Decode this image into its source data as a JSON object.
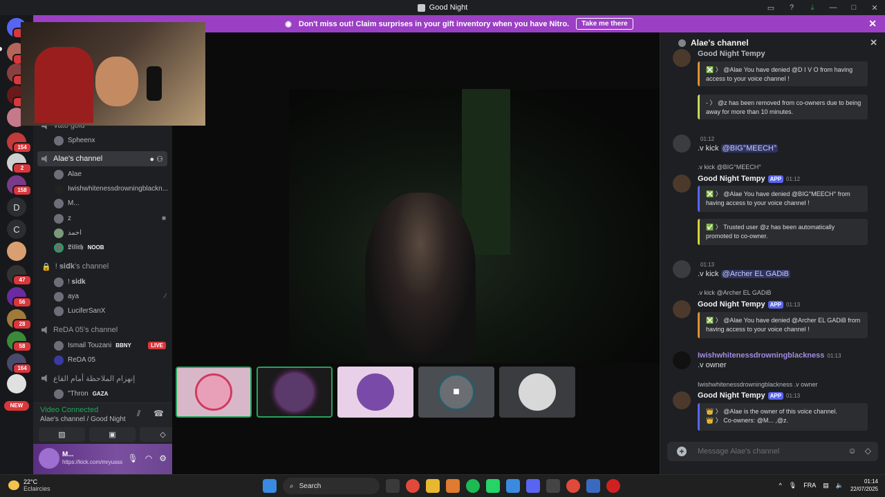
{
  "window": {
    "title": "Good Night"
  },
  "nitro_banner": {
    "text": "Don't miss out! Claim surprises in your gift inventory when you have Nitro.",
    "button": "Take me there"
  },
  "guilds": {
    "badges": [
      "7",
      "1",
      "1",
      "6",
      "154",
      "2",
      "158",
      "47",
      "56",
      "28",
      "58",
      "164"
    ],
    "letters": [
      "D",
      "C"
    ],
    "new_label": "NEW"
  },
  "channels": {
    "prev_channel_partial": "Vato gold",
    "prev_member": "Spheenx",
    "current": {
      "name": "Alae's channel",
      "members": [
        {
          "name": "Alae"
        },
        {
          "name": "Iwishwhitenessdrowningblackn..."
        },
        {
          "name": "M..."
        },
        {
          "name": "z"
        },
        {
          "name": "احمد"
        },
        {
          "name": "𝕷𝖎𝖑𝖎𝖙𝖍",
          "tag": "NOOB"
        }
      ]
    },
    "sidk": {
      "name": "! 𝐬𝐢𝐝𝐤's channel",
      "members": [
        {
          "name": "! 𝐬𝐢𝐝𝐤"
        },
        {
          "name": "aya"
        },
        {
          "name": "LuciferSanX"
        }
      ]
    },
    "reda": {
      "name": "ReDA 05's channel",
      "members": [
        {
          "name": "Ismail Touzani",
          "tag": "BBNY",
          "live": "LIVE"
        },
        {
          "name": "ReDA 05"
        }
      ]
    },
    "arabic": {
      "name": "إنهزام الملاحظة أمام القاع",
      "members": [
        {
          "name": "\"Thron",
          "tag": "GAZA"
        }
      ]
    }
  },
  "voice_panel": {
    "status": "Video Connected",
    "location": "Alae's channel / Good Night"
  },
  "user_panel": {
    "name": "M...",
    "status": "https://kick.com/mryusss"
  },
  "chat": {
    "header": "Alae's channel",
    "top_partial": "Good Night Tempy",
    "messages": [
      {
        "embed1": "❎ 〉 @Alae You have denied @D I V O from having access to your voice channel !"
      },
      {
        "embed2": "- 〉 @z has been removed from co-owners due to being away for more than 10 minutes."
      },
      {
        "time": "01:12",
        "text": ".v kick",
        "mention": "@BIG°MEECH°"
      },
      {
        "reply": ".v kick @BIG°MEECH°",
        "author": "Good Night Tempy",
        "app": "APP",
        "time": "01:12",
        "embed1": "❎ 〉 @Alae You have denied @BIG°MEECH° from having access to your voice channel !",
        "embed2": "✅ 〉 Trusted user @z has been automatically promoted to co-owner."
      },
      {
        "time": "01:13",
        "text": ".v kick",
        "mention": "@Archer EL GADiB"
      },
      {
        "reply": ".v kick @Archer EL GADiB",
        "author": "Good Night Tempy",
        "app": "APP",
        "time": "01:13",
        "embed1": "❎ 〉 @Alae You have denied @Archer EL GADiB from having access to your voice channel !"
      },
      {
        "author": "Iwishwhitenessdrowningblackness",
        "time": "01:13",
        "text": ".v owner"
      },
      {
        "reply": "Iwishwhitenessdrowningblackness .v owner",
        "author": "Good Night Tempy",
        "app": "APP",
        "time": "01:13",
        "embed1": "👑 〉 @Alae is the owner of this voice channel.",
        "embed2": "👑 〉 Co-owners: @M... ,@z."
      }
    ],
    "input_placeholder": "Message Alae's channel"
  },
  "taskbar": {
    "temp": "22°C",
    "weather": "Eclaircies",
    "search": "Search",
    "lang": "FRA",
    "time": "01:14",
    "date": "22/07/2025"
  }
}
